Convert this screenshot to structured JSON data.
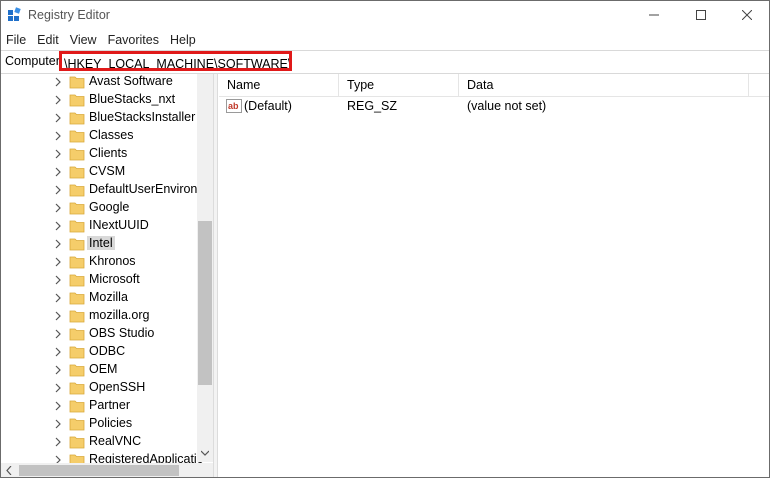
{
  "window": {
    "title": "Registry Editor"
  },
  "menu": [
    "File",
    "Edit",
    "View",
    "Favorites",
    "Help"
  ],
  "address": {
    "root": "Computer",
    "path": "\\HKEY_LOCAL_MACHINE\\SOFTWARE\\Intel"
  },
  "tree": {
    "items": [
      "Avast Software",
      "BlueStacks_nxt",
      "BlueStacksInstaller",
      "Classes",
      "Clients",
      "CVSM",
      "DefaultUserEnvironn",
      "Google",
      "INextUUID",
      "Intel",
      "Khronos",
      "Microsoft",
      "Mozilla",
      "mozilla.org",
      "OBS Studio",
      "ODBC",
      "OEM",
      "OpenSSH",
      "Partner",
      "Policies",
      "RealVNC",
      "RegisteredApplicatic"
    ],
    "selected": "Intel"
  },
  "list": {
    "columns": [
      "Name",
      "Type",
      "Data"
    ],
    "rows": [
      {
        "name": "(Default)",
        "type": "REG_SZ",
        "data": "(value not set)"
      }
    ]
  },
  "colors": {
    "highlight_border": "#e01919",
    "selection": "#d9d9d9",
    "folder": "#f5cd6a"
  }
}
